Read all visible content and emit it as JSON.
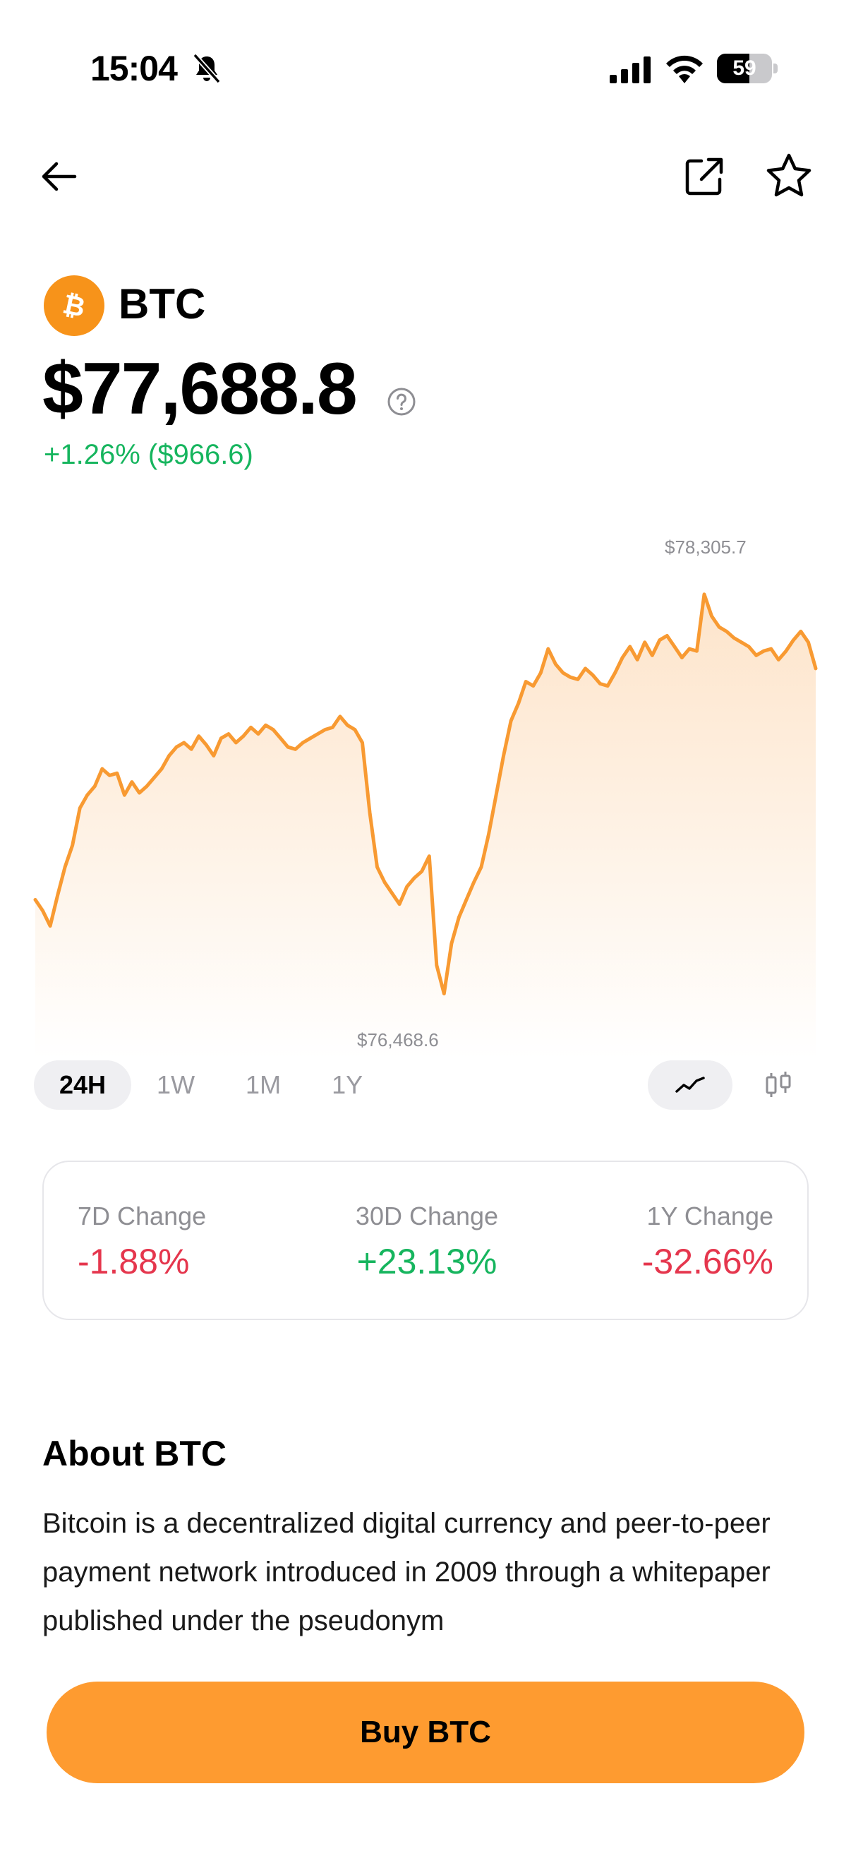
{
  "status_bar": {
    "time": "15:04",
    "battery_level": "59",
    "icons": [
      "bell-slash-icon",
      "signal-icon",
      "wifi-icon",
      "battery-icon"
    ]
  },
  "nav": {
    "icons": [
      "back-arrow-icon",
      "share-icon",
      "star-icon"
    ]
  },
  "coin": {
    "symbol": "BTC",
    "price": "$77,688.8",
    "change": "+1.26% ($966.6)",
    "logo_color": "#f7931a"
  },
  "chart_data": {
    "type": "area",
    "high_label": "$78,305.7",
    "low_label": "$76,468.6",
    "ylim": [
      76300,
      78500
    ],
    "line_color": "#f89a32",
    "y": [
      76900,
      76850,
      76780,
      76920,
      77050,
      77150,
      77320,
      77380,
      77420,
      77500,
      77470,
      77480,
      77380,
      77440,
      77390,
      77420,
      77460,
      77500,
      77560,
      77600,
      77620,
      77590,
      77650,
      77610,
      77560,
      77640,
      77660,
      77620,
      77650,
      77690,
      77660,
      77700,
      77680,
      77640,
      77600,
      77590,
      77620,
      77640,
      77660,
      77680,
      77690,
      77740,
      77700,
      77680,
      77620,
      77300,
      77050,
      76980,
      76930,
      76880,
      76960,
      77000,
      77030,
      77100,
      76600,
      76470,
      76700,
      76820,
      76900,
      76980,
      77050,
      77200,
      77380,
      77560,
      77720,
      77800,
      77900,
      77880,
      77940,
      78050,
      77980,
      77940,
      77920,
      77910,
      77960,
      77930,
      77890,
      77880,
      77940,
      78010,
      78060,
      78000,
      78080,
      78020,
      78090,
      78110,
      78060,
      78010,
      78050,
      78040,
      78300,
      78200,
      78150,
      78130,
      78100,
      78080,
      78060,
      78020,
      78040,
      78050,
      78000,
      78040,
      78090,
      78130,
      78080,
      77960
    ]
  },
  "periods": {
    "tabs": [
      "24H",
      "1W",
      "1M",
      "1Y"
    ],
    "active": "24H",
    "chart_modes": [
      "line-chart-icon",
      "candlestick-chart-icon"
    ],
    "active_mode": "line"
  },
  "stats": {
    "d7": {
      "label": "7D Change",
      "value": "-1.88%",
      "color": "#e5364d"
    },
    "d30": {
      "label": "30D Change",
      "value": "+23.13%",
      "color": "#16b55e"
    },
    "y1": {
      "label": "1Y Change",
      "value": "-32.66%",
      "color": "#e5364d"
    }
  },
  "about": {
    "title": "About BTC",
    "text": "Bitcoin is a decentralized digital currency and peer-to-peer payment network introduced in 2009 through a whitepaper published under the pseudonym"
  },
  "buy_button": {
    "label": "Buy BTC",
    "color": "#fe9b30"
  }
}
